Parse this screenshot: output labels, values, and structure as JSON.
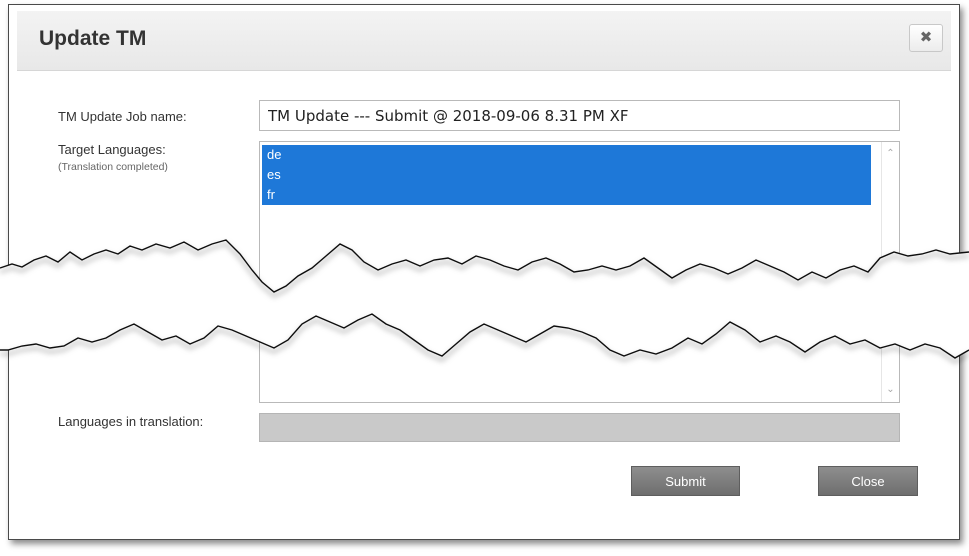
{
  "dialog": {
    "title": "Update TM",
    "close_icon": "close-x-icon",
    "close_glyph": "✖"
  },
  "form": {
    "job_name_label": "TM Update Job name:",
    "job_name_value": "TM Update --- Submit @ 2018-09-06 8.31 PM XF",
    "target_languages_label": "Target Languages:",
    "target_languages_sublabel": "(Translation completed)",
    "target_languages": [
      {
        "code": "de",
        "selected": true
      },
      {
        "code": "es",
        "selected": true
      },
      {
        "code": "fr",
        "selected": true
      }
    ],
    "in_translation_label": "Languages in translation:",
    "in_translation_value": ""
  },
  "buttons": {
    "submit_label": "Submit",
    "close_label": "Close"
  },
  "colors": {
    "selection": "#1e78d8",
    "button": "#7a7a7a",
    "titlebar": "#eeeeee"
  }
}
